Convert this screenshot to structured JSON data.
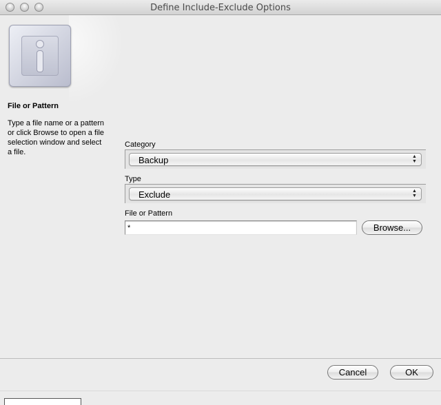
{
  "window": {
    "title": "Define Include-Exclude Options"
  },
  "info": {
    "heading": "File or Pattern",
    "description": "Type a file name or a pattern or click Browse to open a file selection window and select a file."
  },
  "form": {
    "category_label": "Category",
    "category_value": "Backup",
    "type_label": "Type",
    "type_value": "Exclude",
    "file_label": "File or Pattern",
    "file_value": "*",
    "browse_label": "Browse..."
  },
  "footer": {
    "cancel_label": "Cancel",
    "ok_label": "OK"
  },
  "icons": [
    "info-icon",
    "select-arrows-icon"
  ]
}
